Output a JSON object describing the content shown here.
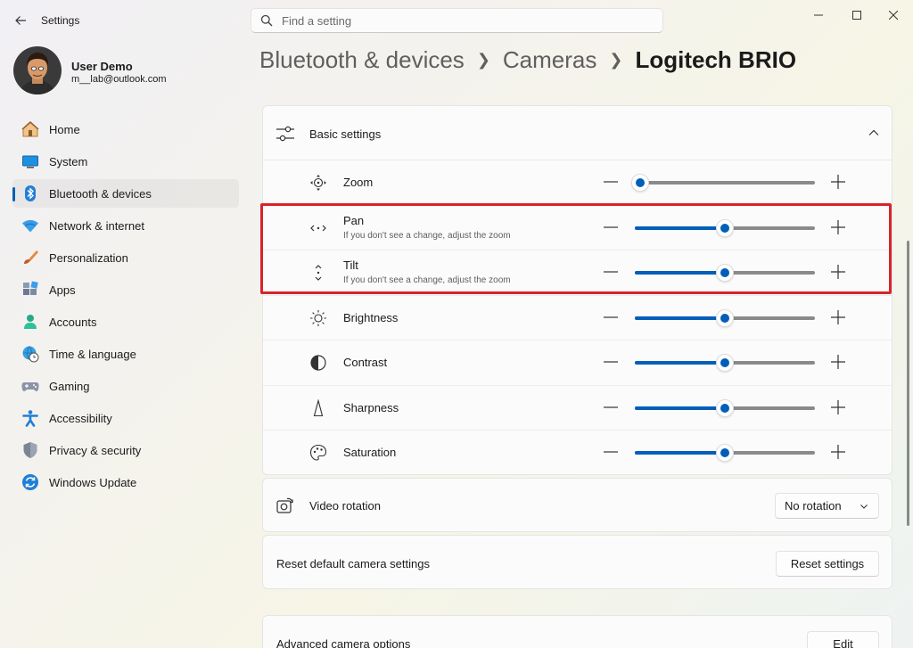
{
  "window": {
    "app_title": "Settings",
    "search_placeholder": "Find a setting"
  },
  "profile": {
    "name": "User Demo",
    "email": "m__lab@outlook.com"
  },
  "sidebar": {
    "items": [
      {
        "label": "Home",
        "icon": "home-icon"
      },
      {
        "label": "System",
        "icon": "system-icon"
      },
      {
        "label": "Bluetooth & devices",
        "icon": "bluetooth-icon",
        "active": true
      },
      {
        "label": "Network & internet",
        "icon": "wifi-icon"
      },
      {
        "label": "Personalization",
        "icon": "brush-icon"
      },
      {
        "label": "Apps",
        "icon": "apps-icon"
      },
      {
        "label": "Accounts",
        "icon": "accounts-icon"
      },
      {
        "label": "Time & language",
        "icon": "globe-clock-icon"
      },
      {
        "label": "Gaming",
        "icon": "gamepad-icon"
      },
      {
        "label": "Accessibility",
        "icon": "accessibility-icon"
      },
      {
        "label": "Privacy & security",
        "icon": "shield-icon"
      },
      {
        "label": "Windows Update",
        "icon": "update-icon"
      }
    ]
  },
  "breadcrumb": {
    "level1": "Bluetooth & devices",
    "level2": "Cameras",
    "current": "Logitech BRIO"
  },
  "basic_settings": {
    "title": "Basic settings",
    "rows": [
      {
        "label": "Zoom",
        "sub": "",
        "icon": "zoom-move-icon",
        "value": 0.03
      },
      {
        "label": "Pan",
        "sub": "If you don't see a change, adjust the zoom",
        "icon": "pan-icon",
        "value": 0.5
      },
      {
        "label": "Tilt",
        "sub": "If you don't see a change, adjust the zoom",
        "icon": "tilt-icon",
        "value": 0.5
      },
      {
        "label": "Brightness",
        "sub": "",
        "icon": "brightness-icon",
        "value": 0.5
      },
      {
        "label": "Contrast",
        "sub": "",
        "icon": "contrast-icon",
        "value": 0.5
      },
      {
        "label": "Sharpness",
        "sub": "",
        "icon": "sharpness-icon",
        "value": 0.5
      },
      {
        "label": "Saturation",
        "sub": "",
        "icon": "saturation-icon",
        "value": 0.5
      }
    ]
  },
  "video_rotation": {
    "label": "Video rotation",
    "value": "No rotation"
  },
  "reset": {
    "label": "Reset default camera settings",
    "button": "Reset settings"
  },
  "advanced": {
    "label": "Advanced camera options",
    "button": "Edit"
  },
  "colors": {
    "accent": "#005fb8",
    "highlight": "#d8232a"
  }
}
